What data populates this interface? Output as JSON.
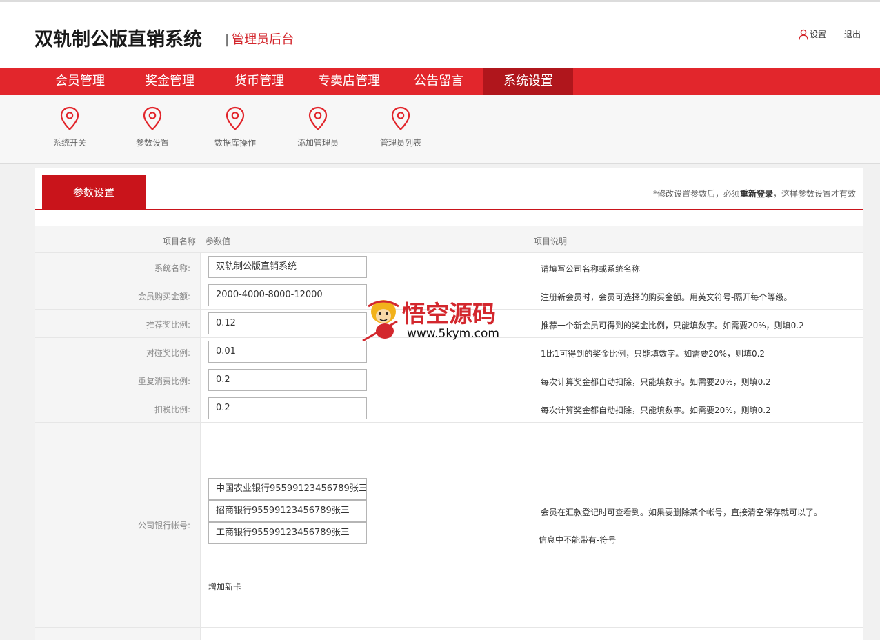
{
  "header": {
    "title": "双轨制公版直销系统",
    "subtitle": "管理员后台",
    "separator": "|",
    "settings_label": "设置",
    "logout_label": "退出"
  },
  "nav": {
    "items": [
      "会员管理",
      "奖金管理",
      "货币管理",
      "专卖店管理",
      "公告留言",
      "系统设置"
    ],
    "active": "系统设置"
  },
  "subnav": {
    "items": [
      "系统开关",
      "参数设置",
      "数据库操作",
      "添加管理员",
      "管理员列表"
    ]
  },
  "panel": {
    "tab_label": "参数设置",
    "note_prefix": "*修改设置参数后，必须",
    "note_emphasis": "重新登录",
    "note_suffix": "，这样参数设置才有效"
  },
  "table": {
    "headers": [
      "项目名称",
      "参数值",
      "项目说明"
    ],
    "rows": [
      {
        "label": "系统名称:",
        "value": "双轨制公版直销系统",
        "desc": "请填写公司名称或系统名称"
      },
      {
        "label": "会员购买金额:",
        "value": "2000-4000-8000-12000",
        "desc": "注册新会员时，会员可选择的购买金额。用英文符号-隔开每个等级。"
      },
      {
        "label": "推荐奖比例:",
        "value": "0.12",
        "desc": "推荐一个新会员可得到的奖金比例，只能填数字。如需要20%，则填0.2"
      },
      {
        "label": "对碰奖比例:",
        "value": "0.01",
        "desc": "1比1可得到的奖金比例，只能填数字。如需要20%，则填0.2"
      },
      {
        "label": "重复消费比例:",
        "value": "0.2",
        "desc": "每次计算奖金都自动扣除，只能填数字。如需要20%，则填0.2"
      },
      {
        "label": "扣税比例:",
        "value": "0.2",
        "desc": "每次计算奖金都自动扣除，只能填数字。如需要20%，则填0.2"
      }
    ],
    "bank": {
      "label": "公司银行帐号:",
      "accounts": [
        "中国农业银行95599123456789张三",
        "招商银行95599123456789张三",
        "工商银行95599123456789张三"
      ],
      "desc1": "会员在汇款登记时可查看到。如果要删除某个帐号，直接清空保存就可以了。",
      "desc2": "信息中不能带有-符号",
      "add_label": "增加新卡"
    }
  },
  "watermark": {
    "text": "悟空源码",
    "url": "www.5kym.com"
  },
  "colors": {
    "brand_red": "#e2262c",
    "active_red": "#b0161c",
    "tab_red": "#c9141b"
  }
}
